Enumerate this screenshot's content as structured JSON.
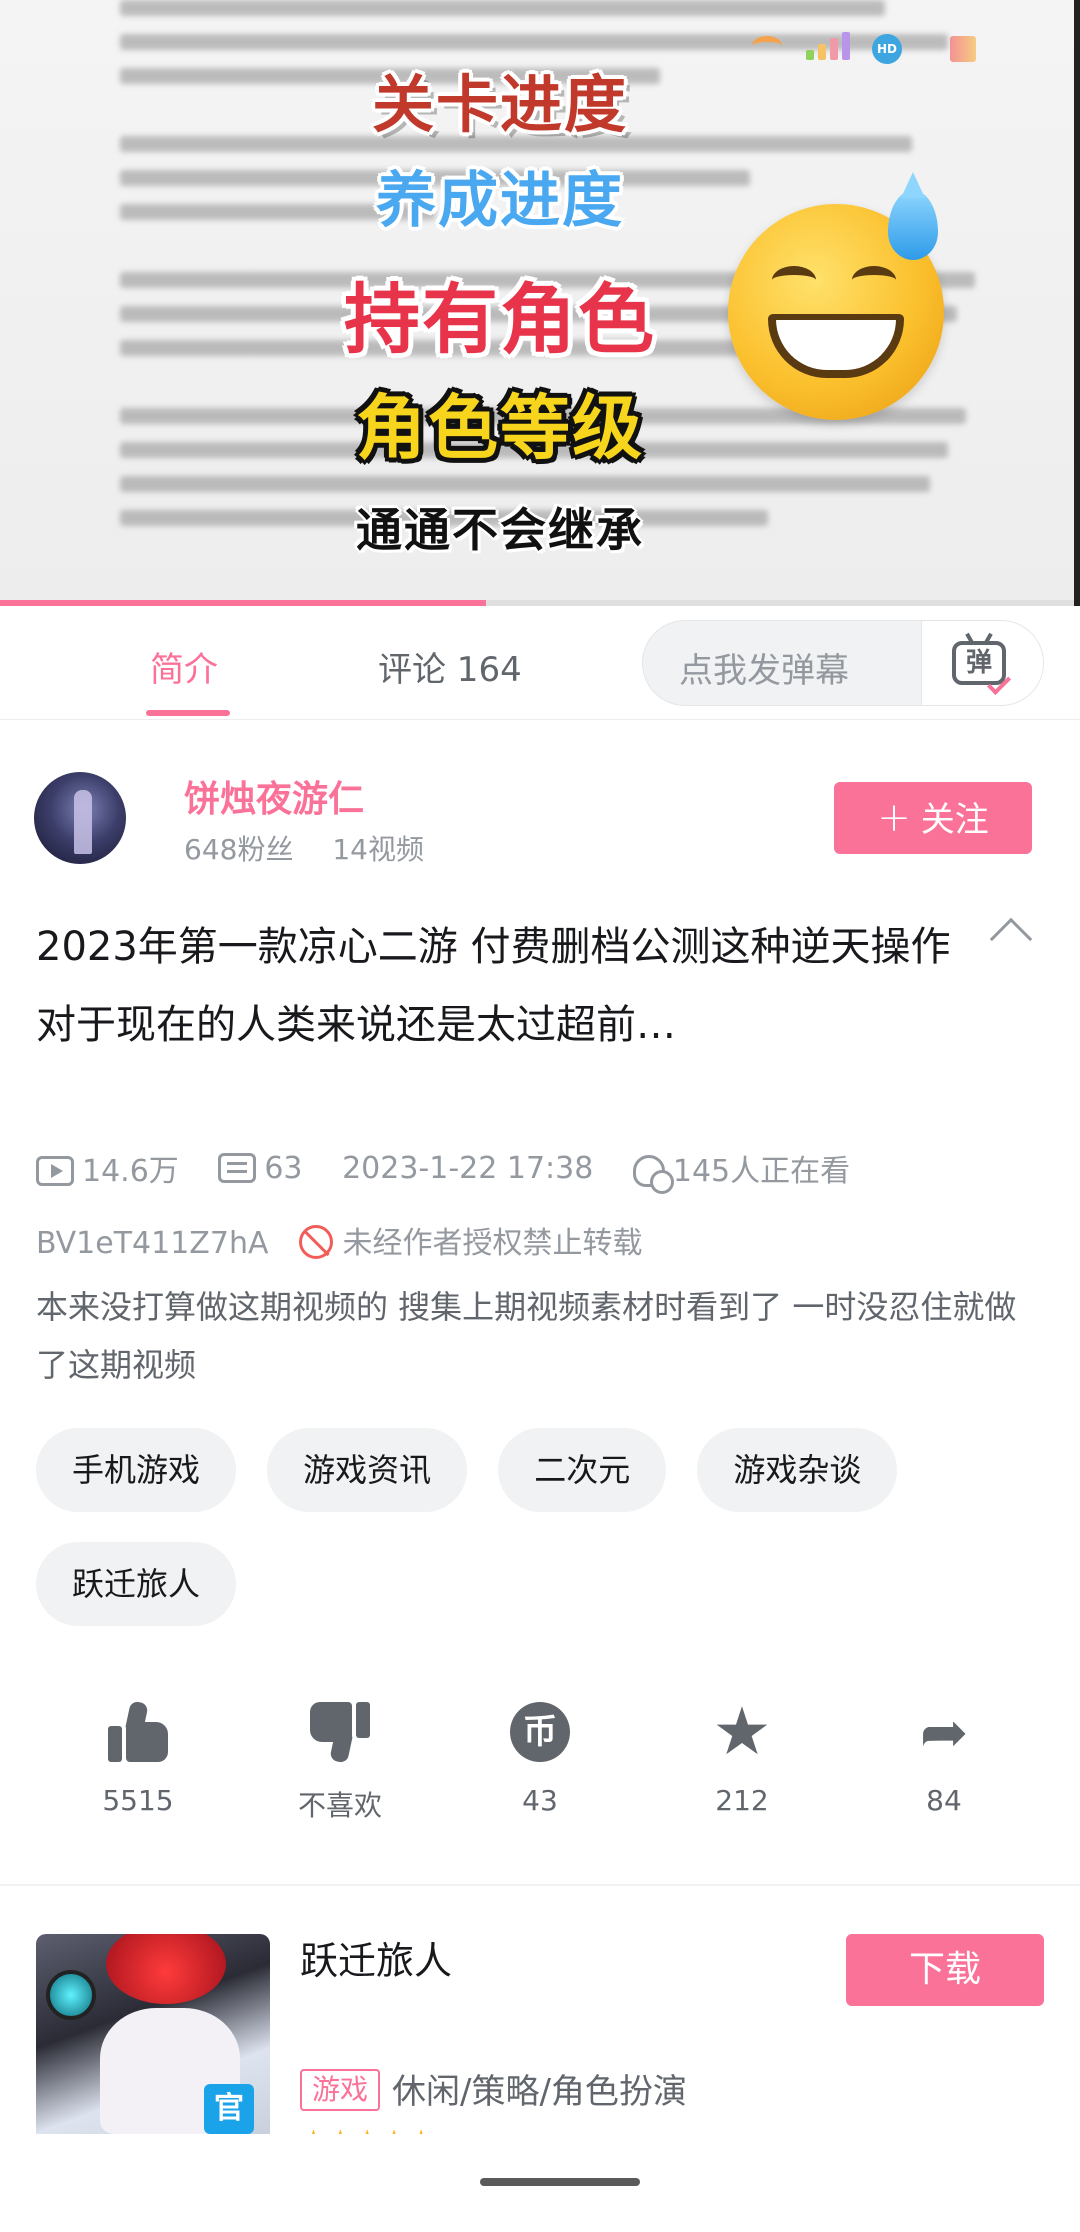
{
  "video": {
    "captions": [
      "关卡进度",
      "养成进度",
      "持有角色",
      "角色等级",
      "通通不会继承"
    ],
    "emoji_icon": "grinning-face-with-sweat-emoji",
    "progress": 0.45
  },
  "tabs": {
    "intro_label": "简介",
    "comments_label": "评论 164",
    "danmaku_placeholder": "点我发弹幕",
    "danmaku_button_glyph": "弹"
  },
  "uploader": {
    "name": "饼烛夜游仁",
    "fans": "648粉丝",
    "videos": "14视频",
    "follow_label": "关注"
  },
  "video_info": {
    "title": "2023年第一款凉心二游 付费删档公测这种逆天操作对于现在的人类来说还是太过超前…",
    "views": "14.6万",
    "danmaku_count": "63",
    "date": "2023-1-22 17:38",
    "watching": "145人正在看",
    "bvid": "BV1eT411Z7hA",
    "no_repost": "未经作者授权禁止转载",
    "description": "本来没打算做这期视频的 搜集上期视频素材时看到了 一时没忍住就做了这期视频"
  },
  "tags": [
    "手机游戏",
    "游戏资讯",
    "二次元",
    "游戏杂谈",
    "跃迁旅人"
  ],
  "actions": {
    "like": "5515",
    "dislike": "不喜欢",
    "coin": "43",
    "favorite": "212",
    "share": "84"
  },
  "game_card": {
    "name": "跃迁旅人",
    "download_label": "下载",
    "type_tag": "游戏",
    "categories": "休闲/策略/角色扮演"
  },
  "colors": {
    "accent": "#fb7299",
    "text_secondary": "#9499a0"
  }
}
